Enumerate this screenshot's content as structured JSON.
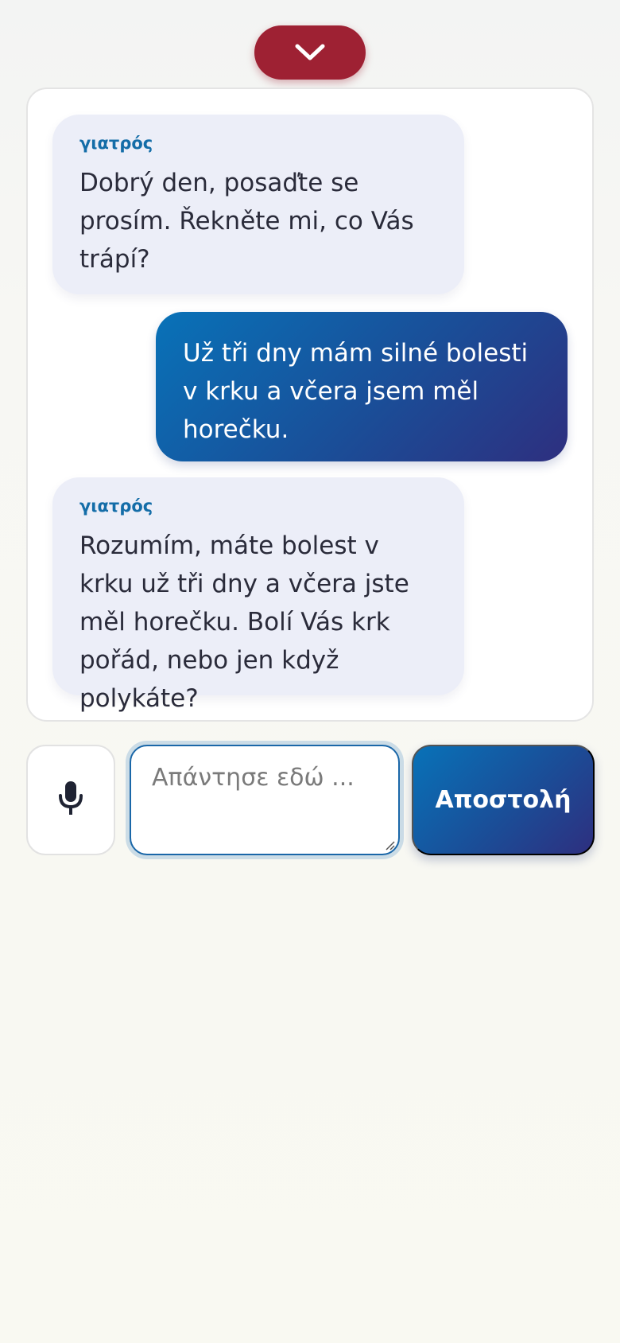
{
  "header": {
    "collapse_icon": "chevron-down-icon",
    "collapse_color": "#9e2133"
  },
  "chat": {
    "messages": [
      {
        "role": "doctor",
        "sender": "γιατρός",
        "text": "Dobrý den, posaďte se prosím. Řekněte mi, co Vás trápí?"
      },
      {
        "role": "patient",
        "text": "Už tři dny mám silné bolesti v krku a včera jsem měl horečku."
      },
      {
        "role": "doctor",
        "sender": "γιατρός",
        "text": "Rozumím, máte bolest v krku už tři dny a včera jste měl horečku. Bolí Vás krk pořád, nebo jen když polykáte?"
      }
    ]
  },
  "composer": {
    "mic_icon": "microphone-icon",
    "placeholder": "Απάντησε εδώ ...",
    "value": "",
    "send_label": "Αποστολή"
  },
  "colors": {
    "accent": "#146da8",
    "doctor_bubble": "#eceef8",
    "patient_bubble_start": "#0872b8",
    "patient_bubble_end": "#2e2f7f",
    "danger": "#9e2133"
  }
}
